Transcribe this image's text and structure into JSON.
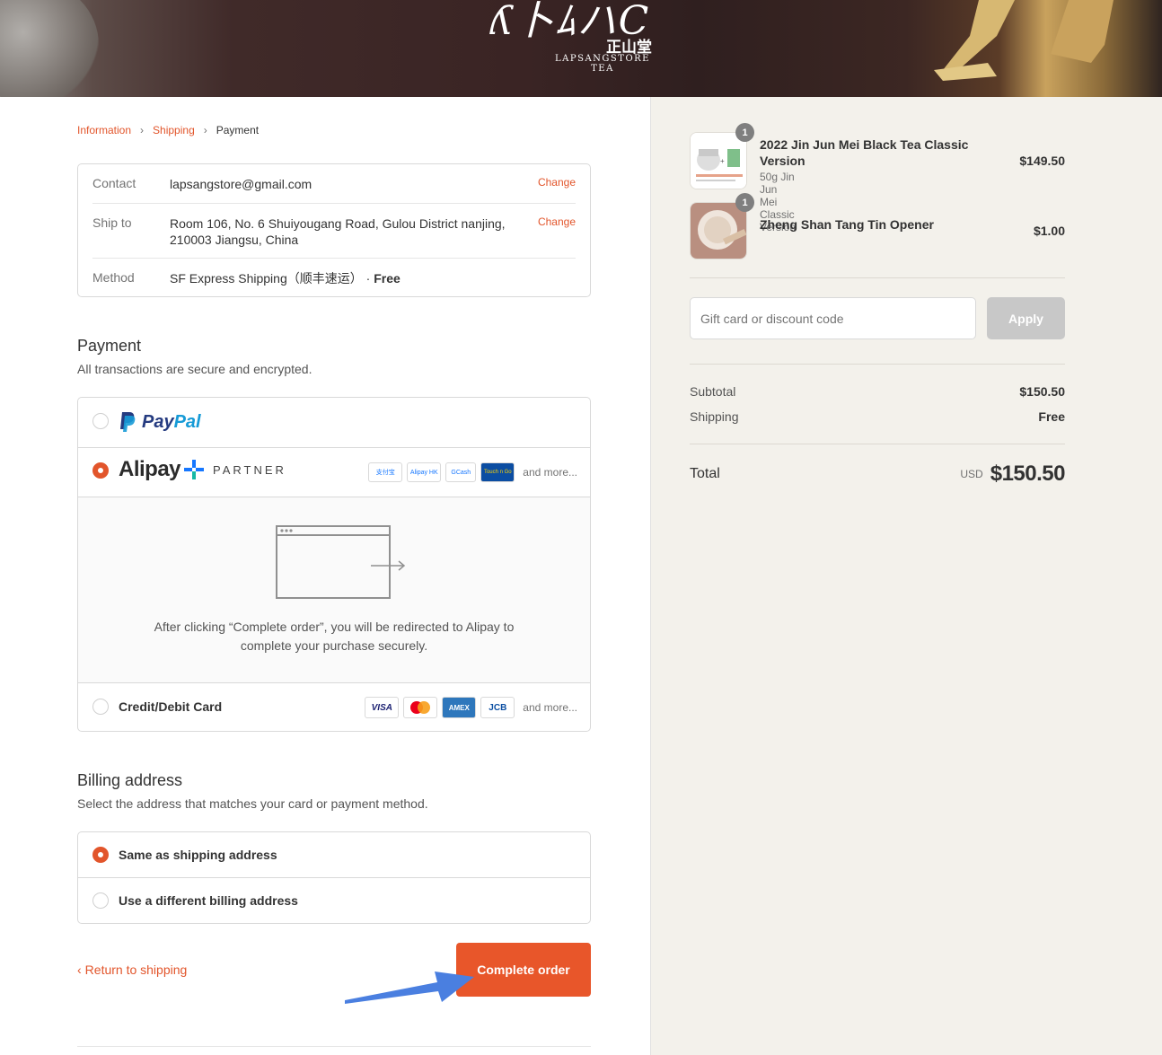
{
  "brand": {
    "logo_mark": "ʎ卜ﾑハC",
    "logo_cn": "正山堂",
    "logo_en": "LAPSANGSTORE TEA"
  },
  "breadcrumb": {
    "information": "Information",
    "shipping": "Shipping",
    "payment": "Payment"
  },
  "review": {
    "contact_label": "Contact",
    "contact_value": "lapsangstore@gmail.com",
    "contact_change": "Change",
    "ship_label": "Ship to",
    "ship_value": "Room 106, No. 6 Shuiyougang Road, Gulou District nanjing, 210003 Jiangsu, China",
    "ship_change": "Change",
    "method_label": "Method",
    "method_value": "SF Express Shipping（顺丰速运）",
    "method_sep": " · ",
    "method_price": "Free"
  },
  "payment": {
    "title": "Payment",
    "subtitle": "All transactions are secure and encrypted.",
    "paypal": {
      "pay": "Pay",
      "pal": "Pal",
      "selected": false
    },
    "alipay": {
      "word": "Alipay",
      "partner": "PARTNER",
      "badges": [
        "支付宝",
        "Alipay HK",
        "GCash",
        "Touch n Go"
      ],
      "more": "and more...",
      "selected": true
    },
    "redirect_text": "After clicking “Complete order”, you will be redirected to Alipay to complete your purchase securely.",
    "card": {
      "label": "Credit/Debit Card",
      "badges": [
        "VISA",
        "Mastercard",
        "AMEX",
        "JCB"
      ],
      "more": "and more...",
      "selected": false
    }
  },
  "billing": {
    "title": "Billing address",
    "subtitle": "Select the address that matches your card or payment method.",
    "same": "Same as shipping address",
    "different": "Use a different billing address",
    "selected": "same"
  },
  "actions": {
    "return": "Return to shipping",
    "complete": "Complete order"
  },
  "summary": {
    "items": [
      {
        "name": "2022 Jin Jun Mei Black Tea Classic Version",
        "variant": "50g Jin Jun Mei Classic Version",
        "qty": "1",
        "price": "$149.50"
      },
      {
        "name": "Zheng Shan Tang Tin Opener",
        "variant": "",
        "qty": "1",
        "price": "$1.00"
      }
    ],
    "discount_placeholder": "Gift card or discount code",
    "apply": "Apply",
    "subtotal_label": "Subtotal",
    "subtotal_value": "$150.50",
    "shipping_label": "Shipping",
    "shipping_value": "Free",
    "total_label": "Total",
    "total_currency": "USD",
    "total_value": "$150.50"
  },
  "colors": {
    "accent": "#e2552b",
    "button": "#e8562a",
    "summary_bg": "#f3f1eb",
    "annotation_arrow": "#4a7fe0"
  }
}
